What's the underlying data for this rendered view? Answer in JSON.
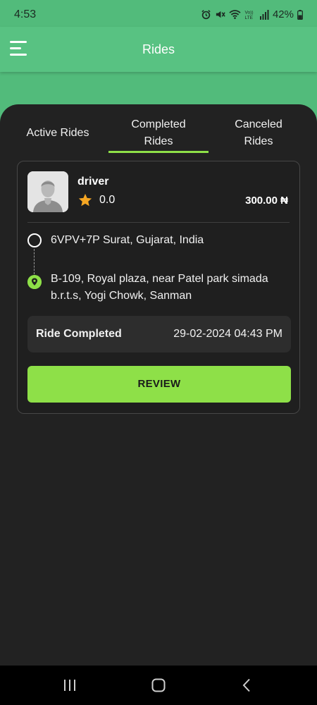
{
  "status_bar": {
    "time": "4:53",
    "battery": "42%",
    "icons": [
      "alarm-icon",
      "mute-icon",
      "wifi-icon",
      "volte-icon",
      "signal-icon",
      "battery-icon"
    ]
  },
  "app_bar": {
    "title": "Rides",
    "menu_icon": "hamburger-menu-icon"
  },
  "tabs": [
    {
      "label": "Active Rides",
      "active": false
    },
    {
      "label": "Completed\nRides",
      "active": true
    },
    {
      "label": "Canceled\nRides",
      "active": false
    }
  ],
  "ride": {
    "driver_name": "driver",
    "rating": "0.0",
    "price": "300.00 ₦",
    "pickup": "6VPV+7P Surat, Gujarat, India",
    "dropoff": "B-109, Royal plaza, near Patel park simada b.r.t.s, Yogi Chowk, Sanman",
    "status_label": "Ride Completed",
    "status_datetime": "29-02-2024 04:43 PM",
    "review_label": "REVIEW"
  },
  "colors": {
    "header_green": "#58c282",
    "accent_green": "#8ee048",
    "panel_bg": "#222222",
    "star": "#f5a623"
  },
  "nav_bar": {
    "icons": [
      "recent-apps-icon",
      "home-icon",
      "back-icon"
    ]
  }
}
